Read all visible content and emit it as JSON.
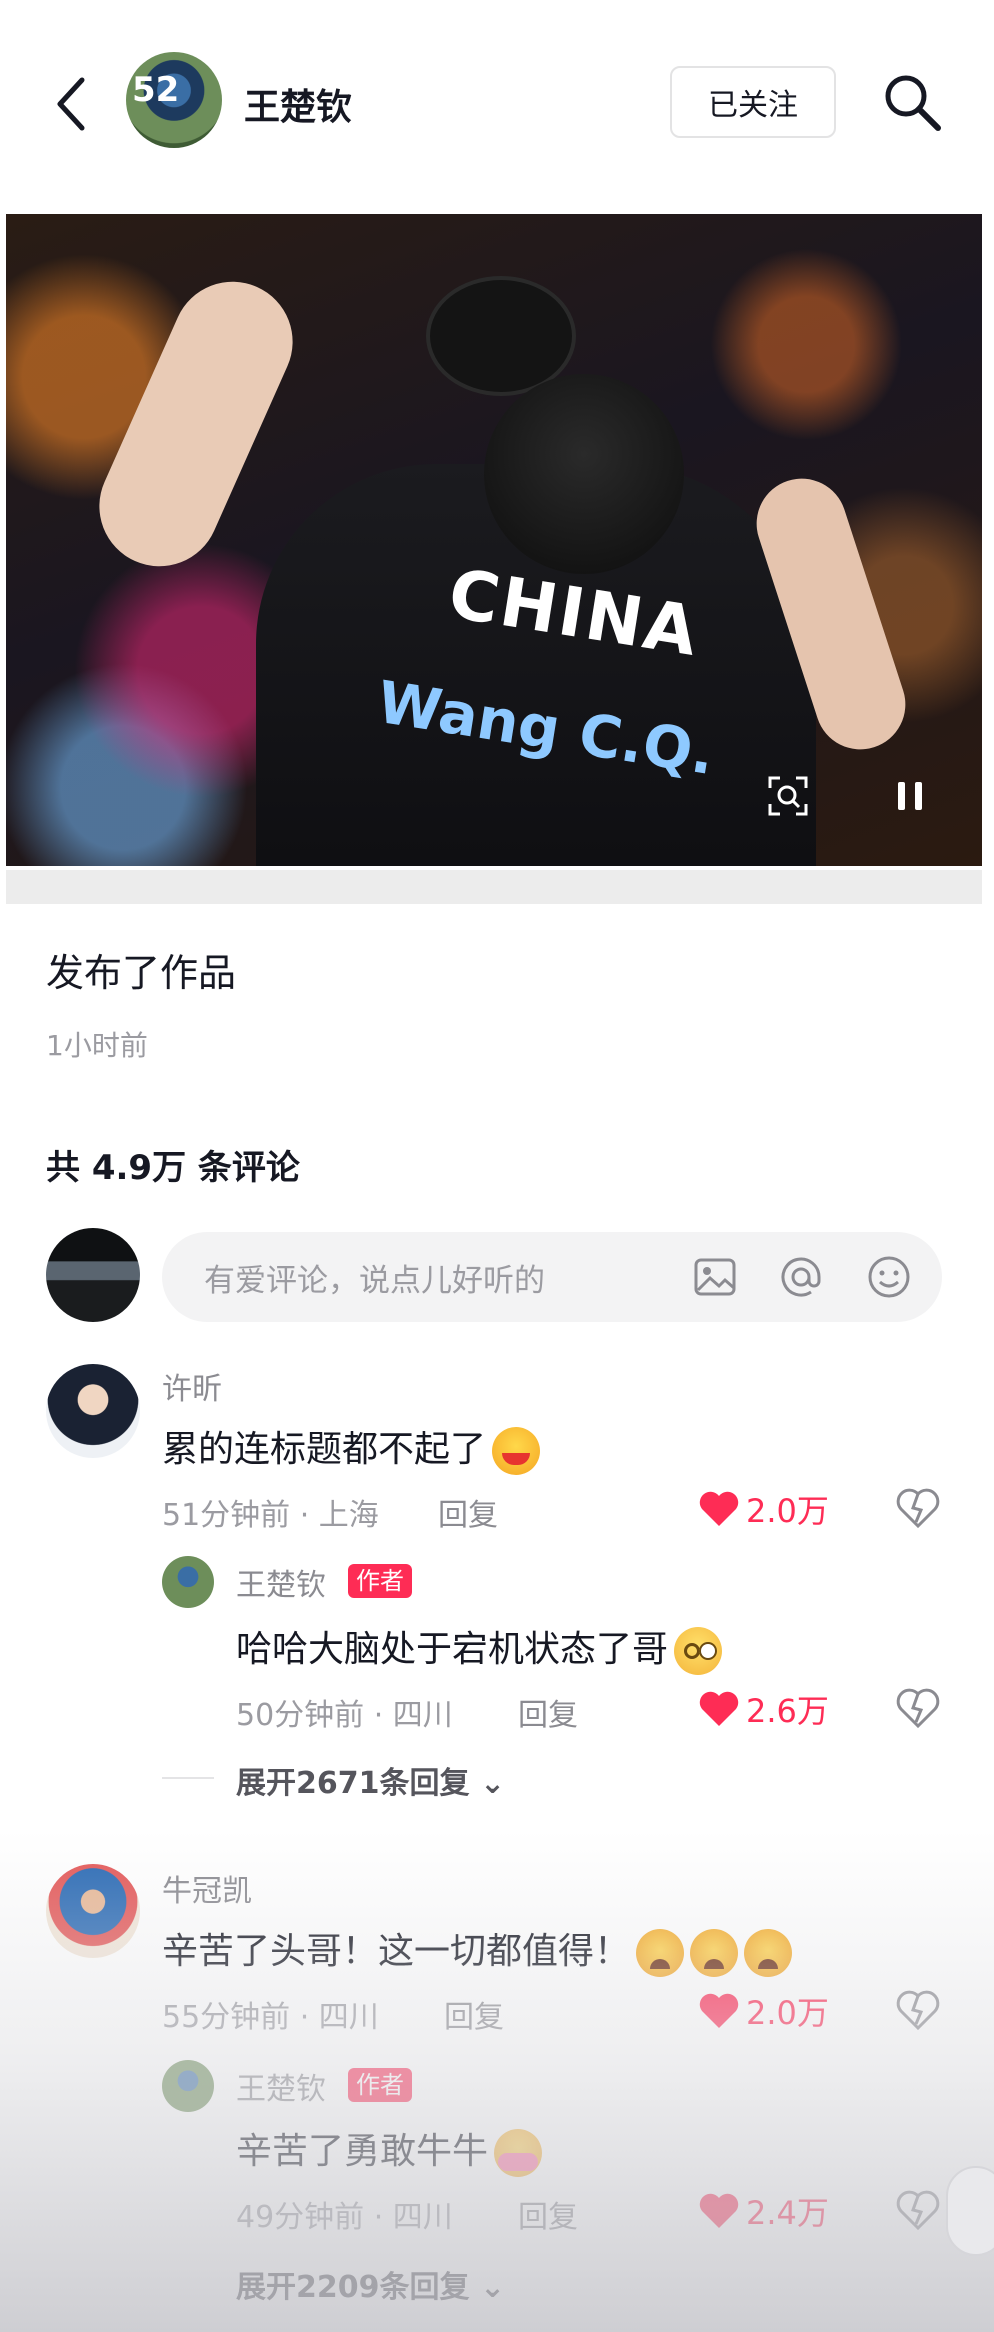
{
  "header": {
    "avatar_number": "52",
    "user_name": "王楚钦",
    "follow_label": "已关注"
  },
  "hero": {
    "jersey_text": "CHINA",
    "name_text": "Wang C.Q."
  },
  "post": {
    "title": "发布了作品",
    "time": "1小时前"
  },
  "comments_header": {
    "count_label": "共 4.9万 条评论"
  },
  "input": {
    "placeholder": "有爱评论，说点儿好听的"
  },
  "comments": [
    {
      "name": "许昕",
      "text": "累的连标题都不起了",
      "meta": "51分钟前 · 上海",
      "reply": "回复",
      "likes": "2.0万",
      "reply_item": {
        "name": "王楚钦",
        "tag": "作者",
        "text": "哈哈大脑处于宕机状态了哥",
        "meta": "50分钟前 · 四川",
        "reply": "回复",
        "likes": "2.6万"
      },
      "expand": "展开2671条回复"
    },
    {
      "name": "牛冠凯",
      "text": "辛苦了头哥！这一切都值得！",
      "meta": "55分钟前 · 四川",
      "reply": "回复",
      "likes": "2.0万",
      "reply_item": {
        "name": "王楚钦",
        "tag": "作者",
        "text": "辛苦了勇敢牛牛",
        "meta": "49分钟前 · 四川",
        "reply": "回复",
        "likes": "2.4万"
      },
      "expand": "展开2209条回复"
    }
  ],
  "colors": {
    "accent": "#fe2c55",
    "text": "#161823",
    "muted": "#9b9ba1"
  }
}
